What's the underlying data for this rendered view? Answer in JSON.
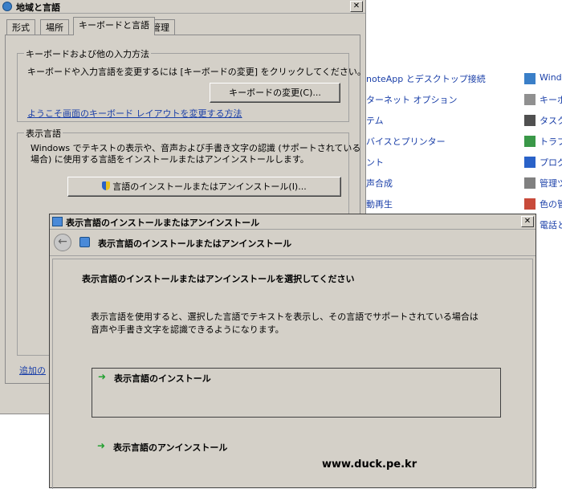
{
  "control_panel": {
    "items_col1": [
      "noteApp とデスクトップ接続",
      "ターネット オプション",
      "テム",
      "バイスとプリンター",
      "ント",
      "声合成",
      "動再生"
    ],
    "items_col2": [
      "Windo",
      "キーボ",
      "タスク",
      "トラブ",
      "プログ",
      "管理ツ",
      "色の管",
      "電話と"
    ]
  },
  "region_dialog": {
    "title": "地域と言語",
    "tabs": [
      "形式",
      "場所",
      "キーボードと言語",
      "管理"
    ],
    "keyboard_group": {
      "title": "キーボードおよび他の入力方法",
      "desc": "キーボードや入力言語を変更するには [キーボードの変更] をクリックしてください。",
      "button": "キーボードの変更(C)...",
      "link": "ようこそ画面のキーボード レイアウトを変更する方法"
    },
    "display_group": {
      "title": "表示言語",
      "desc_line1": "Windows でテキストの表示や、音声および手書き文字の認識 (サポートされている",
      "desc_line2": "場合) に使用する言語をインストールまたはアンインストールします。",
      "button": "言語のインストールまたはアンインストール(I)..."
    },
    "partial_link": "追加の"
  },
  "wizard": {
    "title": "表示言語のインストールまたはアンインストール",
    "header_title": "表示言語のインストールまたはアンインストール",
    "heading": "表示言語のインストールまたはアンインストールを選択してください",
    "desc_line1": "表示言語を使用すると、選択した言語でテキストを表示し、その言語でサポートされている場合は",
    "desc_line2": "音声や手書き文字を認識できるようになります。",
    "option_install": "表示言語のインストール",
    "option_uninstall": "表示言語のアンインストール",
    "watermark": "www.duck.pe.kr"
  }
}
